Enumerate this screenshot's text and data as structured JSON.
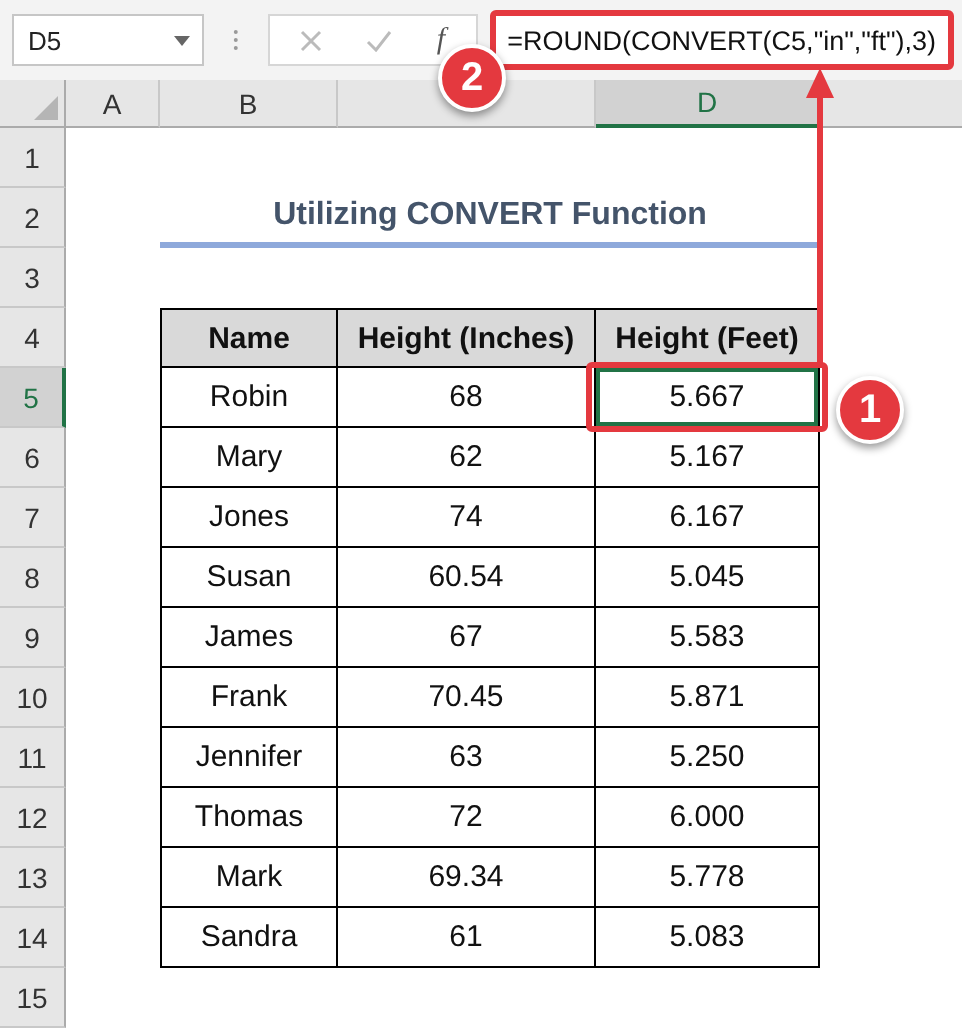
{
  "name_box": "D5",
  "function_label": "f",
  "formula": "=ROUND(CONVERT(C5,\"in\",\"ft\"),3)",
  "columns": [
    {
      "label": "A",
      "selected": false
    },
    {
      "label": "B",
      "selected": false
    },
    {
      "selected": false
    },
    {
      "label": "D",
      "selected": true
    }
  ],
  "row_numbers": [
    {
      "label": "1",
      "selected": false
    },
    {
      "label": "2",
      "selected": false
    },
    {
      "label": "3",
      "selected": false
    },
    {
      "label": "4",
      "selected": false
    },
    {
      "label": "5",
      "selected": true
    },
    {
      "label": "6",
      "selected": false
    },
    {
      "label": "7",
      "selected": false
    },
    {
      "label": "8",
      "selected": false
    },
    {
      "label": "9",
      "selected": false
    },
    {
      "label": "10",
      "selected": false
    },
    {
      "label": "11",
      "selected": false
    },
    {
      "label": "12",
      "selected": false
    },
    {
      "label": "13",
      "selected": false
    },
    {
      "label": "14",
      "selected": false
    },
    {
      "label": "15",
      "selected": false
    }
  ],
  "title": "Utilizing CONVERT Function",
  "table": {
    "columns": [
      "Name",
      "Height (Inches)",
      "Height (Feet)"
    ],
    "rows": [
      {
        "name": "Robin",
        "inches": "68",
        "feet": "5.667",
        "selected": true
      },
      {
        "name": "Mary",
        "inches": "62",
        "feet": "5.167",
        "selected": false
      },
      {
        "name": "Jones",
        "inches": "74",
        "feet": "6.167",
        "selected": false
      },
      {
        "name": "Susan",
        "inches": "60.54",
        "feet": "5.045",
        "selected": false
      },
      {
        "name": "James",
        "inches": "67",
        "feet": "5.583",
        "selected": false
      },
      {
        "name": "Frank",
        "inches": "70.45",
        "feet": "5.871",
        "selected": false
      },
      {
        "name": "Jennifer",
        "inches": "63",
        "feet": "5.250",
        "selected": false
      },
      {
        "name": "Thomas",
        "inches": "72",
        "feet": "6.000",
        "selected": false
      },
      {
        "name": "Mark",
        "inches": "69.34",
        "feet": "5.778",
        "selected": false
      },
      {
        "name": "Sandra",
        "inches": "61",
        "feet": "5.083",
        "selected": false
      }
    ]
  },
  "callouts": [
    {
      "label": "1"
    },
    {
      "label": "2"
    }
  ]
}
